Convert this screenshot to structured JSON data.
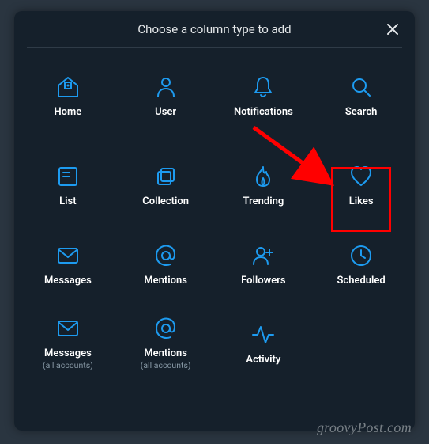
{
  "header": {
    "title": "Choose a column type to add"
  },
  "items": {
    "home": {
      "label": "Home"
    },
    "user": {
      "label": "User"
    },
    "notifications": {
      "label": "Notifications"
    },
    "search": {
      "label": "Search"
    },
    "list": {
      "label": "List"
    },
    "collection": {
      "label": "Collection"
    },
    "trending": {
      "label": "Trending"
    },
    "likes": {
      "label": "Likes"
    },
    "messages": {
      "label": "Messages"
    },
    "mentions": {
      "label": "Mentions"
    },
    "followers": {
      "label": "Followers"
    },
    "scheduled": {
      "label": "Scheduled"
    },
    "messages_all": {
      "label": "Messages",
      "sublabel": "(all accounts)"
    },
    "mentions_all": {
      "label": "Mentions",
      "sublabel": "(all accounts)"
    },
    "activity": {
      "label": "Activity"
    }
  },
  "watermark": "groovyPost.com",
  "accent_color": "#1d9bf0",
  "highlight_color": "#ff0000"
}
